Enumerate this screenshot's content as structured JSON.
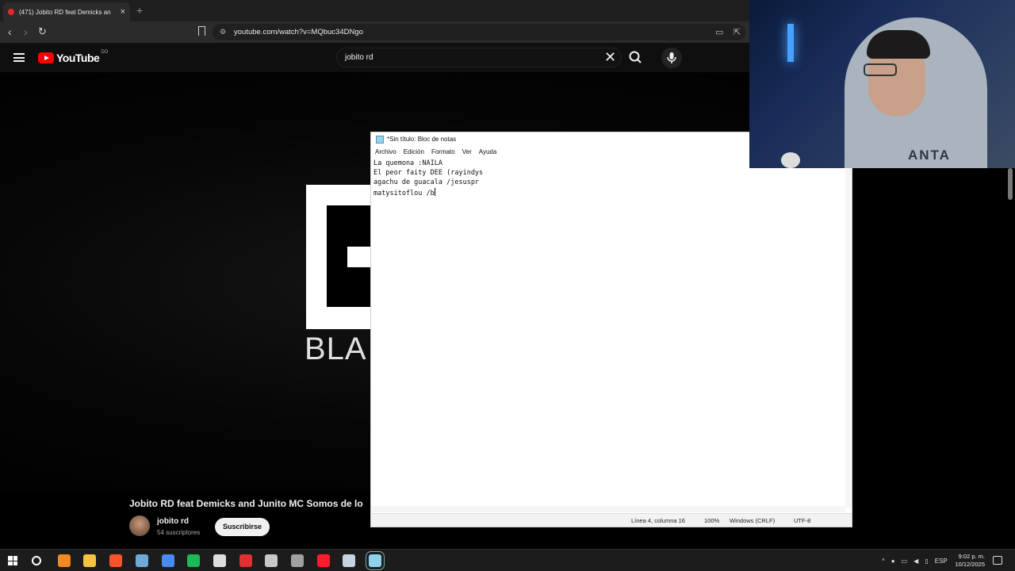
{
  "browser": {
    "tab_title": "(471) Jobito RD feat Demicks an",
    "new_tab": "+",
    "tab_close": "×",
    "url": "youtube.com/watch?v=MQbuc34DNgo"
  },
  "youtube": {
    "logo_text": "YouTube",
    "logo_country": "DO",
    "search_value": "jobito rd",
    "search_clear": "✕",
    "video_overlay_text": "BLA",
    "video_title": "Jobito RD feat Demicks and Junito MC Somos de lo",
    "channel_name": "jobito rd",
    "subscribers": "54 suscriptores",
    "subscribe_label": "Suscribirse"
  },
  "notepad": {
    "title": "*Sin título: Bloc de notas",
    "menu": [
      "Archivo",
      "Edición",
      "Formato",
      "Ver",
      "Ayuda"
    ],
    "lines": [
      "La quemona :NAILA",
      "El peor faity DEE (rayindys",
      "agachu de guacala /jesuspr",
      "matysitoflou /b"
    ],
    "status": {
      "position": "Línea 4, columna 16",
      "zoom": "100%",
      "line_ending": "Windows (CRLF)",
      "encoding": "UTF-8"
    }
  },
  "webcam": {
    "shirt_text": "ANTA"
  },
  "taskbar": {
    "apps": [
      {
        "icon": "search-icon",
        "color": "#ffffff"
      },
      {
        "icon": "vlc-icon",
        "color": "#f08a24"
      },
      {
        "icon": "file-explorer-icon",
        "color": "#f5c242"
      },
      {
        "icon": "brave-icon",
        "color": "#fb542b"
      },
      {
        "icon": "calculator-icon",
        "color": "#6fa9d8"
      },
      {
        "icon": "chrome-icon",
        "color": "#4a8af4"
      },
      {
        "icon": "spotify-icon",
        "color": "#1db954"
      },
      {
        "icon": "capcut-icon",
        "color": "#dddddd"
      },
      {
        "icon": "app-x-icon",
        "color": "#e03131"
      },
      {
        "icon": "app-avatar-icon",
        "color": "#c8c8c8"
      },
      {
        "icon": "obs-icon",
        "color": "#a0a0a0"
      },
      {
        "icon": "opera-icon",
        "color": "#ff1b2d"
      },
      {
        "icon": "steam-icon",
        "color": "#c6d4df"
      },
      {
        "icon": "notepad-icon",
        "color": "#8fd0ea"
      }
    ],
    "language": "ESP",
    "time": "9:02 p. m.",
    "date": "10/12/2025"
  }
}
